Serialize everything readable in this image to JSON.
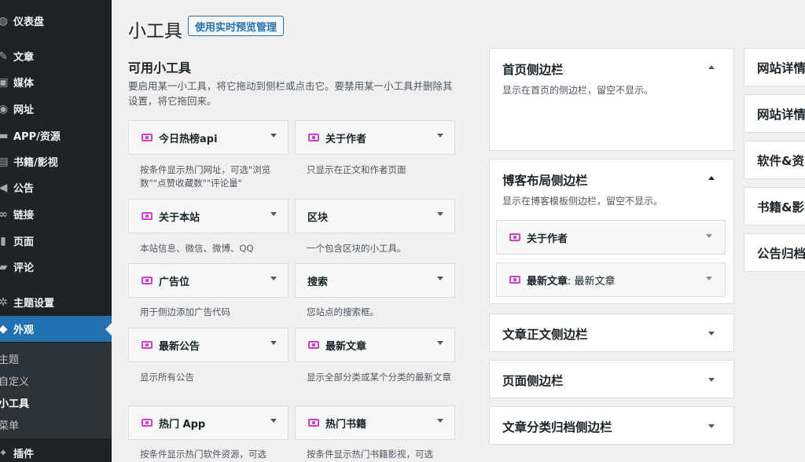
{
  "sidebar": {
    "items": [
      {
        "label": "仪表盘",
        "icon": "dashboard-icon",
        "glyph": "◍"
      },
      {
        "label": "文章",
        "icon": "pin-icon",
        "glyph": "✎"
      },
      {
        "label": "媒体",
        "icon": "media-icon",
        "glyph": "▣"
      },
      {
        "label": "网址",
        "icon": "globe-icon",
        "glyph": "◉"
      },
      {
        "label": "APP/资源",
        "icon": "app-icon",
        "glyph": "▬"
      },
      {
        "label": "书籍/影视",
        "icon": "book-icon",
        "glyph": "▤"
      },
      {
        "label": "公告",
        "icon": "megaphone-icon",
        "glyph": "◀"
      },
      {
        "label": "链接",
        "icon": "link-icon",
        "glyph": "∞"
      },
      {
        "label": "页面",
        "icon": "page-icon",
        "glyph": "▮"
      },
      {
        "label": "评论",
        "icon": "comment-icon",
        "glyph": "▰"
      },
      {
        "label": "主题设置",
        "icon": "gear-icon",
        "glyph": "✲"
      },
      {
        "label": "外观",
        "icon": "brush-icon",
        "glyph": "◆"
      },
      {
        "label": "插件",
        "icon": "plugin-icon",
        "glyph": "✦"
      }
    ],
    "submenu": [
      "主题",
      "自定义",
      "小工具",
      "菜单"
    ],
    "active_color": "#2271b1"
  },
  "header": {
    "title": "小工具",
    "manage_button": "使用实时预览管理"
  },
  "available": {
    "title": "可用小工具",
    "desc": "要启用某一小工具，将它拖动到侧栏或点击它。要禁用某一小工具并删除其设置，将它拖回来。",
    "widgets": [
      {
        "name": "今日热榜api",
        "desc": "按条件显示热门网址，可选\"浏览数\"\"点赞收藏数\"\"评论量\""
      },
      {
        "name": "关于作者",
        "desc": "只显示在正文和作者页面"
      },
      {
        "name": "关于本站",
        "desc": "本站信息、微信、微博、QQ"
      },
      {
        "name": "区块",
        "desc": "一个包含区块的小工具。"
      },
      {
        "name": "广告位",
        "desc": "用于侧边添加广告代码"
      },
      {
        "name": "搜索",
        "desc": "您站点的搜索框。"
      },
      {
        "name": "最新公告",
        "desc": "显示所有公告"
      },
      {
        "name": "最新文章",
        "desc": "显示全部分类或某个分类的最新文章"
      },
      {
        "name": "热门 App",
        "desc": "按条件显示热门软件资源，可选"
      },
      {
        "name": "热门书籍",
        "desc": "按条件显示热门书籍影视，可选"
      }
    ]
  },
  "areas": {
    "home": {
      "title": "首页侧边栏",
      "desc": "显示在首页的侧边栏，留空不显示。"
    },
    "blog": {
      "title": "博客布局侧边栏",
      "desc": "显示在博客模板侧边栏，留空不显示。",
      "widgets": [
        {
          "name": "关于作者",
          "suffix": ""
        },
        {
          "name": "最新文章",
          "suffix": ": 最新文章"
        }
      ]
    },
    "post": {
      "title": "文章正文侧边栏"
    },
    "page": {
      "title": "页面侧边栏"
    },
    "archive": {
      "title": "文章分类归档侧边栏"
    }
  },
  "right_column": [
    "网站详情",
    "网站详情",
    "软件&资",
    "书籍&影",
    "公告归档"
  ],
  "colors": {
    "widget_icon": "#d63bd1",
    "link": "#2271b1"
  }
}
